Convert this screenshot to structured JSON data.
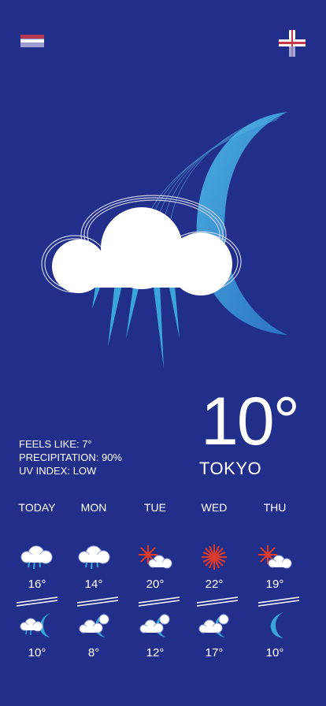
{
  "header": {
    "menu_icon": "flag-menu-icon",
    "add_icon": "plus-icon",
    "colors": {
      "stripe1": "#c43a4a",
      "stripe2": "#ffffff",
      "stripe3": "#8b8fc5"
    }
  },
  "current": {
    "icon": "night-rain-icon",
    "temperature": "10°",
    "city": "TOKYO",
    "feels_like": "FEELS LIKE: 7°",
    "precipitation": "PRECIPITATION: 90%",
    "uv_index": "UV INDEX: LOW"
  },
  "forecast": [
    {
      "day": "TODAY",
      "day_icon": "rain-cloud-icon",
      "high": "16°",
      "night_icon": "moon-rain-cloud-icon",
      "low": "10°"
    },
    {
      "day": "MON",
      "day_icon": "rain-cloud-icon",
      "high": "14°",
      "night_icon": "moon-cloud-icon",
      "low": "8°"
    },
    {
      "day": "TUE",
      "day_icon": "sun-cloud-icon",
      "high": "20°",
      "night_icon": "moon-cloud-icon",
      "low": "12°"
    },
    {
      "day": "WED",
      "day_icon": "sun-icon",
      "high": "22°",
      "night_icon": "moon-cloud-icon",
      "low": "17°"
    },
    {
      "day": "THU",
      "day_icon": "sun-cloud-icon",
      "high": "19°",
      "night_icon": "moon-icon",
      "low": "10°"
    }
  ],
  "colors": {
    "background": "#222f8a",
    "accent_blue": "#3aa5dc",
    "sun_red": "#d83a2e",
    "text": "#ffffff"
  }
}
